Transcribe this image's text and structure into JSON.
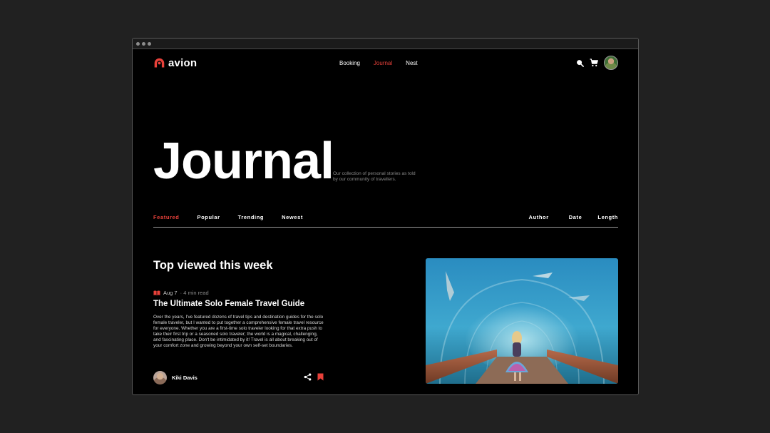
{
  "brand": {
    "name": "avion",
    "accent": "#e8413a"
  },
  "nav": {
    "items": [
      {
        "label": "Booking",
        "active": false
      },
      {
        "label": "Journal",
        "active": true
      },
      {
        "label": "Nest",
        "active": false
      }
    ],
    "icons": [
      "search-icon",
      "cart-icon",
      "user-avatar"
    ]
  },
  "hero": {
    "title": "Journal",
    "subtitle": "Our collection of personal stories as told by our community of travellers."
  },
  "tabs": {
    "left": [
      {
        "label": "Featured",
        "active": true
      },
      {
        "label": "Popular",
        "active": false
      },
      {
        "label": "Trending",
        "active": false
      },
      {
        "label": "Newest",
        "active": false
      }
    ],
    "right": [
      {
        "label": "Author"
      },
      {
        "label": "Date"
      },
      {
        "label": "Length"
      }
    ]
  },
  "featured": {
    "section_title": "Top viewed this week",
    "date": "Aug 7",
    "read_time": "· 4 min read",
    "title": "The Ultimate Solo Female Travel Guide",
    "body": "Over the years, I've featured dozens of travel tips and destination guides for the solo female traveler, but I wanted to put together a comprehensive female travel resource for everyone. Whether you are a first-time solo traveler looking for that extra push to take their first trip or a seasoned solo traveler; the world is a magical, challenging, and fascinating place. Don't be intimidated by it! Travel is all about breaking out of your comfort zone and growing beyond your own self-set boundaries.",
    "author": "Kiki Davis",
    "icons": [
      "book-icon",
      "share-icon",
      "bookmark-icon"
    ]
  },
  "image": {
    "subject": "aquarium-tunnel-photo"
  }
}
